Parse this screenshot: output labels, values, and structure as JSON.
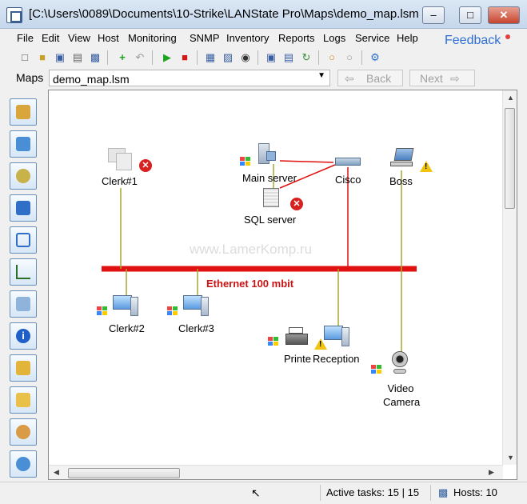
{
  "window": {
    "title": "[C:\\Users\\0089\\Documents\\10-Strike\\LANState Pro\\Maps\\demo_map.lsm",
    "minimize_label": "–",
    "maximize_label": "□",
    "close_label": "✕"
  },
  "menu": {
    "items": [
      "File",
      "Edit",
      "View",
      "Host",
      "Monitoring",
      "SNMP",
      "Inventory",
      "Reports",
      "Logs",
      "Service",
      "Help"
    ],
    "feedback": "Feedback"
  },
  "mapsbar": {
    "label": "Maps",
    "selected_map": "demo_map.lsm",
    "back_label": "Back",
    "next_label": "Next"
  },
  "map": {
    "watermark": "www.LamerKomp.ru",
    "ethernet_label": "Ethernet 100 mbit",
    "ethernet_color": "#e01010",
    "link_color_ok": "#a5a832",
    "link_color_alert": "#e01010",
    "devices": [
      {
        "name": "Clerk#1",
        "icon": "workstation-icon",
        "status": "down"
      },
      {
        "name": "Main server",
        "icon": "server-icon",
        "status": "up"
      },
      {
        "name": "SQL server",
        "icon": "server-icon",
        "status": "down"
      },
      {
        "name": "Cisco",
        "icon": "router-icon",
        "status": "up"
      },
      {
        "name": "Boss",
        "icon": "laptop-icon",
        "status": "warning"
      },
      {
        "name": "Clerk#2",
        "icon": "workstation-icon",
        "status": "up"
      },
      {
        "name": "Clerk#3",
        "icon": "workstation-icon",
        "status": "up"
      },
      {
        "name": "Printe",
        "icon": "printer-icon",
        "status": "up"
      },
      {
        "name": "Reception",
        "icon": "workstation-icon",
        "status": "up"
      },
      {
        "name": "Video\nCamera",
        "icon": "webcam-icon",
        "status": "up"
      }
    ]
  },
  "status": {
    "active_tasks": "Active tasks: 15 | 15",
    "hosts": "Hosts: 10"
  }
}
